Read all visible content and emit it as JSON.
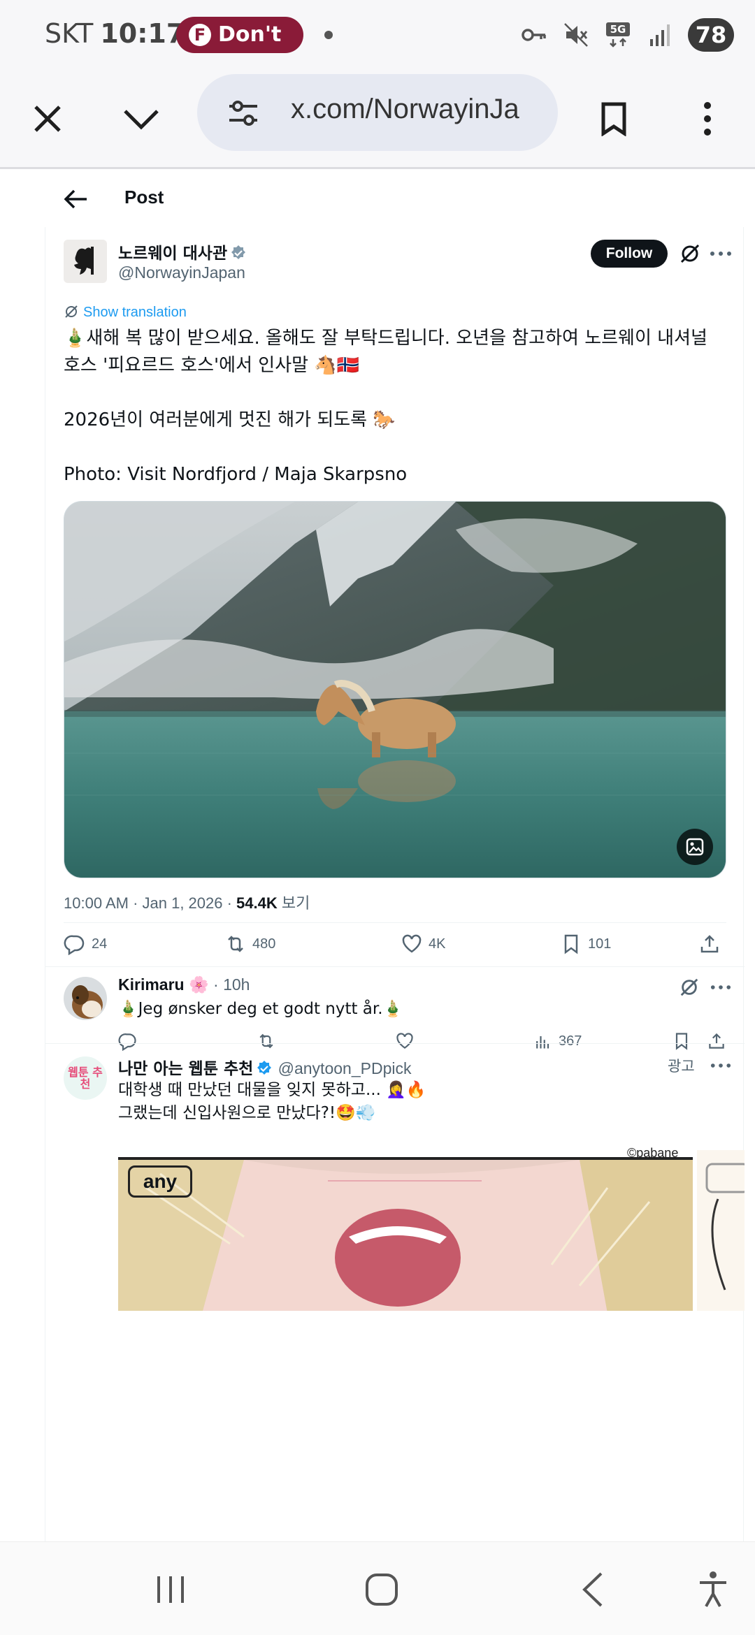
{
  "status_bar": {
    "carrier": "SKT",
    "time": "10:17",
    "notification_pill": "Don't",
    "battery": "78",
    "icons": [
      "key-icon",
      "mute-icon",
      "5g-icon",
      "signal-icon"
    ]
  },
  "browser": {
    "url": "x.com/NorwayinJa",
    "buttons": [
      "close-icon",
      "chevron-down-icon",
      "site-settings-icon",
      "bookmark-icon",
      "menu-icon"
    ]
  },
  "header": {
    "title": "Post"
  },
  "post": {
    "author_name": "노르웨이 대사관",
    "author_handle": "@NorwayinJapan",
    "follow_label": "Follow",
    "show_translation": "Show translation",
    "text_line1": "🎍새해 복 많이 받으세요. 올해도 잘 부탁드립니다. 오년을 참고하여 노르웨이 내셔널 호스 '피요르드 호스'에서 인사말 🐴🇳🇴",
    "text_line2": "2026년이 여러분에게 멋진 해가 되도록 🐎",
    "text_line3": "Photo: Visit Nordfjord / Maja Skarpsno",
    "time": "10:00 AM · Jan 1, 2026 · ",
    "views": "54.4K",
    "views_label": " 보기",
    "stats": {
      "replies": "24",
      "reposts": "480",
      "likes": "4K",
      "bookmarks": "101"
    }
  },
  "reply": {
    "name": "Kirimaru",
    "name_emoji": "🌸",
    "time": " · 10h",
    "text": "🎍Jeg ønsker deg et godt nytt år.🎍",
    "views": "367"
  },
  "ad": {
    "avatar_text": "웹툰 추천",
    "name": "나만 아는 웹툰 추천",
    "handle": "@anytoon_PDpick",
    "ad_label": "광고",
    "text_line1": "대학생 때 만났던 대물을 잊지 못하고... 🤦‍♀️🔥",
    "text_line2": "그랬는데 신입사원으로 만났다?!🤩💨",
    "credit": "©pabane",
    "brand": "any"
  },
  "colors": {
    "accent": "#1d9bf0",
    "pill": "#8a1b38",
    "text": "#0f1419",
    "muted": "#536471"
  }
}
